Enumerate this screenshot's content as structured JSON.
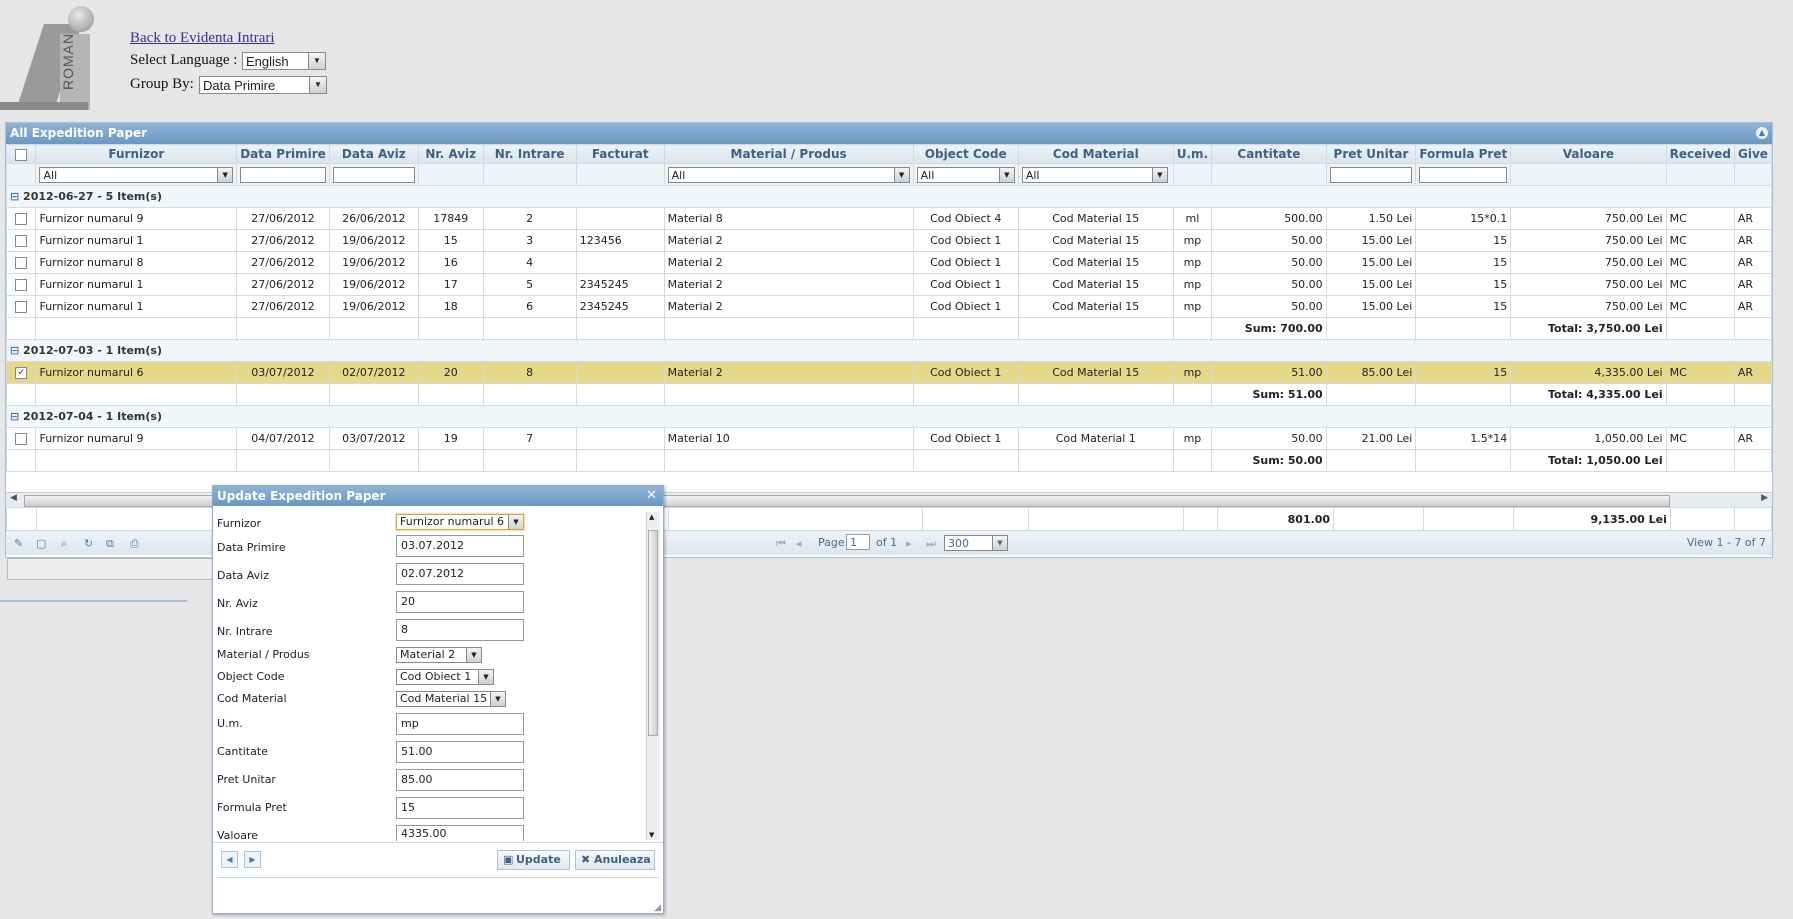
{
  "logo": {
    "text": "ROMAN"
  },
  "top": {
    "back_link": "Back to Evidenta Intrari ",
    "language_label": "Select Language :",
    "language_value": "English",
    "groupby_label": "Group By:",
    "groupby_value": "Data Primire"
  },
  "grid": {
    "title": "All Expedition Paper",
    "columns": [
      "Furnizor",
      "Data Primire",
      "Data Aviz",
      "Nr. Aviz",
      "Nr. Intrare",
      "Facturat",
      "Material / Produs",
      "Object Code",
      "Cod Material",
      "U.m.",
      "Cantitate",
      "Pret Unitar",
      "Formula Pret",
      "Valoare",
      "Received",
      "Give"
    ],
    "filters": {
      "furnizor": "All",
      "material": "All",
      "object_code": "All",
      "cod_material": "All"
    },
    "groups": [
      {
        "label": "2012-06-27 - 5 Item(s)",
        "rows": [
          [
            "Furnizor numarul 9",
            "27/06/2012",
            "26/06/2012",
            "17849",
            "2",
            "",
            "Material 8",
            "Cod Obiect 4",
            "Cod Material 15",
            "ml",
            "500.00",
            "1.50 Lei",
            "15*0.1",
            "750.00 Lei",
            "MC",
            "AR"
          ],
          [
            "Furnizor numarul 1",
            "27/06/2012",
            "19/06/2012",
            "15",
            "3",
            "123456",
            "Material 2",
            "Cod Obiect 1",
            "Cod Material 15",
            "mp",
            "50.00",
            "15.00 Lei",
            "15",
            "750.00 Lei",
            "MC",
            "AR"
          ],
          [
            "Furnizor numarul 8",
            "27/06/2012",
            "19/06/2012",
            "16",
            "4",
            "",
            "Material 2",
            "Cod Obiect 1",
            "Cod Material 15",
            "mp",
            "50.00",
            "15.00 Lei",
            "15",
            "750.00 Lei",
            "MC",
            "AR"
          ],
          [
            "Furnizor numarul 1",
            "27/06/2012",
            "19/06/2012",
            "17",
            "5",
            "2345245",
            "Material 2",
            "Cod Obiect 1",
            "Cod Material 15",
            "mp",
            "50.00",
            "15.00 Lei",
            "15",
            "750.00 Lei",
            "MC",
            "AR"
          ],
          [
            "Furnizor numarul 1",
            "27/06/2012",
            "19/06/2012",
            "18",
            "6",
            "2345245",
            "Material 2",
            "Cod Obiect 1",
            "Cod Material 15",
            "mp",
            "50.00",
            "15.00 Lei",
            "15",
            "750.00 Lei",
            "MC",
            "AR"
          ]
        ],
        "sum": "Sum: 700.00",
        "total": "Total: 3,750.00 Lei"
      },
      {
        "label": "2012-07-03 - 1 Item(s)",
        "rows": [
          [
            "Furnizor numarul 6",
            "03/07/2012",
            "02/07/2012",
            "20",
            "8",
            "",
            "Material 2",
            "Cod Obiect 1",
            "Cod Material 15",
            "mp",
            "51.00",
            "85.00 Lei",
            "15",
            "4,335.00 Lei",
            "MC",
            "AR"
          ]
        ],
        "sum": "Sum: 51.00",
        "total": "Total: 4,335.00 Lei"
      },
      {
        "label": "2012-07-04 - 1 Item(s)",
        "rows": [
          [
            "Furnizor numarul 9",
            "04/07/2012",
            "03/07/2012",
            "19",
            "7",
            "",
            "Material 10",
            "Cod Obiect 1",
            "Cod Material 1",
            "mp",
            "50.00",
            "21.00 Lei",
            "1.5*14",
            "1,050.00 Lei",
            "MC",
            "AR"
          ]
        ],
        "sum": "Sum: 50.00",
        "total": "Total: 1,050.00 Lei"
      }
    ],
    "grand_sum": "801.00",
    "grand_total": "9,135.00 Lei",
    "pager": {
      "page_label": "Page",
      "page_value": "1",
      "of_label": "of 1",
      "rows_value": "300",
      "view_text": "View 1 - 7 of 7"
    }
  },
  "modal": {
    "title": "Update Expedition Paper",
    "fields": {
      "furnizor": {
        "label": "Furnizor",
        "value": "Furnizor numarul 6"
      },
      "data_primire": {
        "label": "Data Primire",
        "value": "03.07.2012"
      },
      "data_aviz": {
        "label": "Data Aviz",
        "value": "02.07.2012"
      },
      "nr_aviz": {
        "label": "Nr. Aviz",
        "value": "20"
      },
      "nr_intrare": {
        "label": "Nr. Intrare",
        "value": "8"
      },
      "material": {
        "label": "Material / Produs",
        "value": "Material 2"
      },
      "object_code": {
        "label": "Object Code",
        "value": "Cod Obiect 1"
      },
      "cod_material": {
        "label": "Cod Material",
        "value": "Cod Material 15"
      },
      "um": {
        "label": "U.m.",
        "value": "mp"
      },
      "cantitate": {
        "label": "Cantitate",
        "value": "51.00"
      },
      "pret_unitar": {
        "label": "Pret Unitar",
        "value": "85.00"
      },
      "formula_pret": {
        "label": "Formula Pret",
        "value": "15"
      },
      "valoare": {
        "label": "Valoare",
        "value": "4335.00"
      }
    },
    "update_label": "Update",
    "cancel_label": "Anuleaza"
  }
}
